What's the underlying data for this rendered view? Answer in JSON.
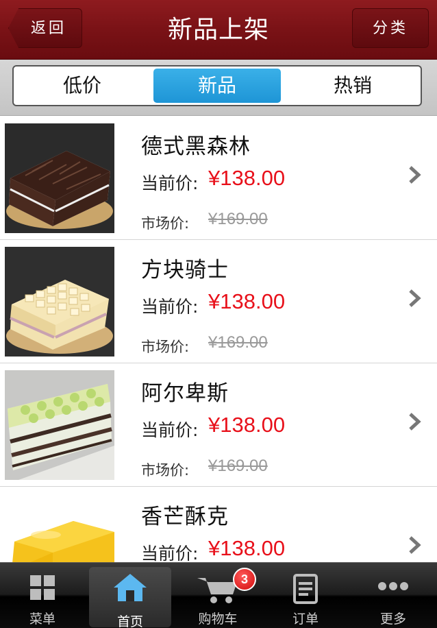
{
  "header": {
    "title": "新品上架",
    "back_label": "返回",
    "category_label": "分类"
  },
  "segments": {
    "items": [
      "低价",
      "新品",
      "热销"
    ],
    "active": "新品"
  },
  "products": [
    {
      "name": "德式黑森林",
      "current_label": "当前价:",
      "current_price": "¥138.00",
      "market_label": "市场价:",
      "market_price": "¥169.00"
    },
    {
      "name": "方块骑士",
      "current_label": "当前价:",
      "current_price": "¥138.00",
      "market_label": "市场价:",
      "market_price": "¥169.00"
    },
    {
      "name": "阿尔卑斯",
      "current_label": "当前价:",
      "current_price": "¥138.00",
      "market_label": "市场价:",
      "market_price": "¥169.00"
    },
    {
      "name": "香芒酥克",
      "current_label": "当前价:",
      "current_price": "¥138.00"
    }
  ],
  "tabbar": {
    "items": [
      {
        "label": "菜单",
        "icon": "grid-icon"
      },
      {
        "label": "首页",
        "icon": "home-icon"
      },
      {
        "label": "购物车",
        "icon": "cart-icon"
      },
      {
        "label": "订单",
        "icon": "order-icon"
      },
      {
        "label": "更多",
        "icon": "more-icon"
      }
    ],
    "active": "首页",
    "cart_badge": "3"
  },
  "colors": {
    "header": "#7a1216",
    "segment_active": "#2aa3df",
    "price": "#e8101a"
  }
}
